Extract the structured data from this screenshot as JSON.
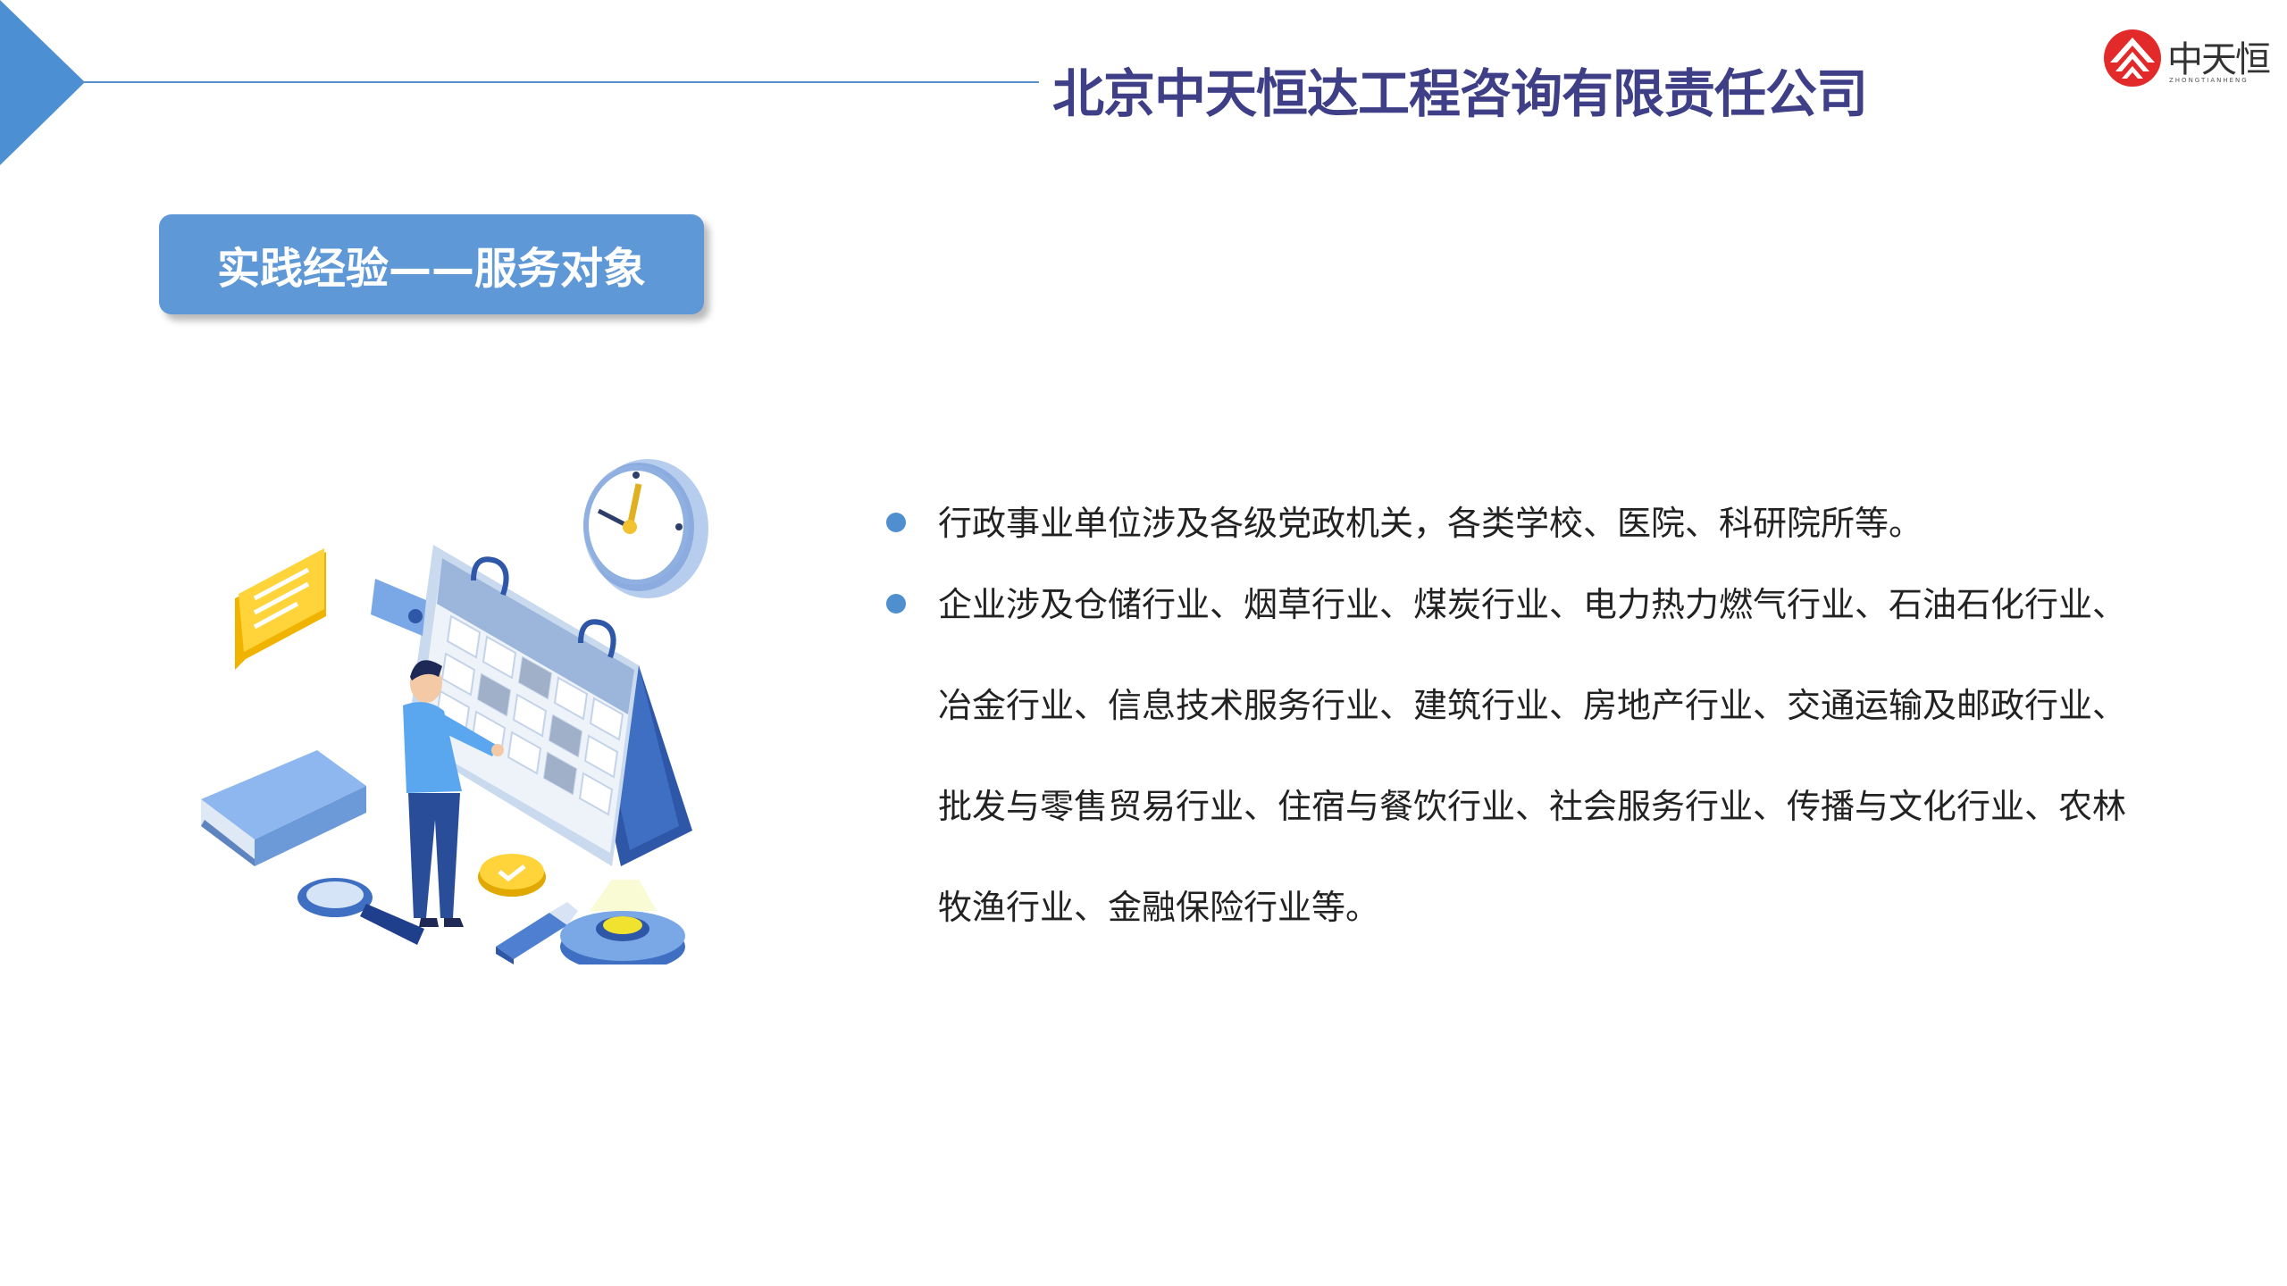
{
  "header": {
    "company_name": "北京中天恒达工程咨询有限责任公司"
  },
  "logo": {
    "text": "中天恒",
    "subtext": "ZHONGTIANHENG",
    "icon": "zth-logo-icon",
    "color": "#e32a2a"
  },
  "section": {
    "title": "实践经验——服务对象"
  },
  "bullets": [
    {
      "text": "行政事业单位涉及各级党政机关，各类学校、医院、科研院所等。"
    },
    {
      "text": "企业涉及仓储行业、烟草行业、煤炭行业、电力热力燃气行业、石油石化行业、冶金行业、信息技术服务行业、建筑行业、房地产行业、交通运输及邮政行业、批发与零售贸易行业、住宿与餐饮行业、社会服务行业、传播与文化行业、农林牧渔行业、金融保险行业等。"
    }
  ],
  "colors": {
    "accent_blue": "#5e98d6",
    "title_navy": "#3e3f86",
    "bullet_blue": "#4f8fd0"
  }
}
